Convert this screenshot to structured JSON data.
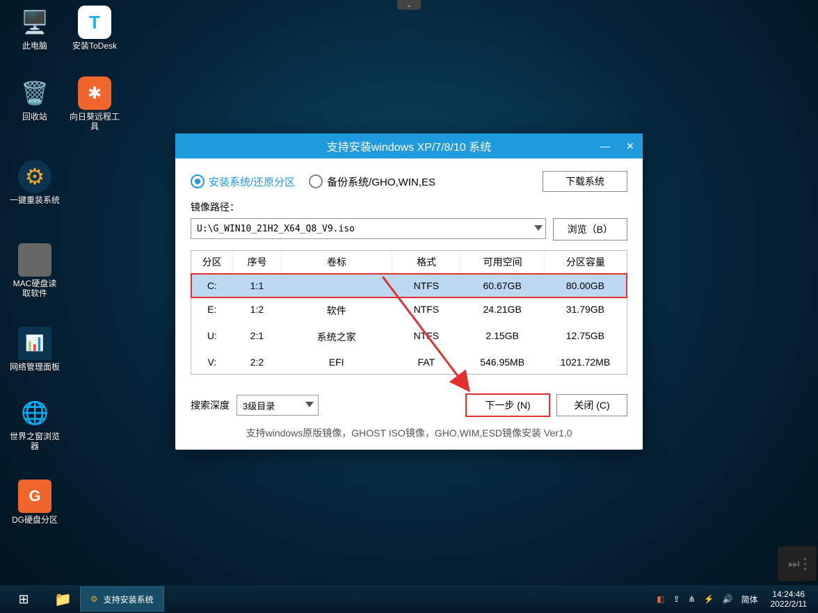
{
  "desktop_icons": [
    {
      "label": "此电脑",
      "icon": "🖥️",
      "bg": ""
    },
    {
      "label": "安装ToDesk",
      "icon": "T",
      "bg": "#fff",
      "fg": "#1fb5e0"
    },
    {
      "label": "回收站",
      "icon": "🗑️",
      "bg": ""
    },
    {
      "label": "向日葵远程工\n具",
      "icon": "✖",
      "bg": "#f0652c",
      "fg": "#fff"
    },
    {
      "label": "一键重装系统",
      "icon": "⚙",
      "bg": "#0a3450",
      "fg": "#f5a623"
    },
    {
      "label": "MAC硬盘读\n取软件",
      "icon": "⊞",
      "bg": "#4a4a4a",
      "fg": "#ddd"
    },
    {
      "label": "网络管理面板",
      "icon": "📊",
      "bg": "#0a3450"
    },
    {
      "label": "世界之窗浏览\n器",
      "icon": "🌐",
      "bg": ""
    },
    {
      "label": "DG硬盘分区",
      "icon": "G",
      "bg": "#f0652c",
      "fg": "#fff"
    }
  ],
  "window": {
    "title": "支持安装windows XP/7/8/10 系统",
    "radio_install": "安装系统/还原分区",
    "radio_backup": "备份系统/GHO,WIN,ES",
    "download_btn": "下载系统",
    "path_label": "镜像路径：",
    "path_value": "U:\\G_WIN10_21H2_X64_Q8_V9.iso",
    "browse_btn": "浏览（B）",
    "headers": {
      "c1": "分区",
      "c2": "序号",
      "c3": "卷标",
      "c4": "格式",
      "c5": "可用空间",
      "c6": "分区容量"
    },
    "rows": [
      {
        "p": "C:",
        "n": "1:1",
        "v": "",
        "f": "NTFS",
        "free": "60.67GB",
        "cap": "80.00GB",
        "sel": true
      },
      {
        "p": "E:",
        "n": "1:2",
        "v": "软件",
        "f": "NTFS",
        "free": "24.21GB",
        "cap": "31.79GB"
      },
      {
        "p": "U:",
        "n": "2:1",
        "v": "系统之家",
        "f": "NTFS",
        "free": "2.15GB",
        "cap": "12.75GB"
      },
      {
        "p": "V:",
        "n": "2:2",
        "v": "EFI",
        "f": "FAT",
        "free": "546.95MB",
        "cap": "1021.72MB"
      }
    ],
    "search_label": "搜索深度",
    "search_value": "3级目录",
    "next_btn": "下一步 (N)",
    "close_btn": "关闭 (C)",
    "footer": "支持windows原版镜像，GHOST ISO镜像，GHO,WIM,ESD镜像安装 Ver1.0"
  },
  "taskbar": {
    "app_title": "支持安装系统",
    "ime": "简体",
    "time": "14:24:46",
    "date": "2022/2/11"
  }
}
